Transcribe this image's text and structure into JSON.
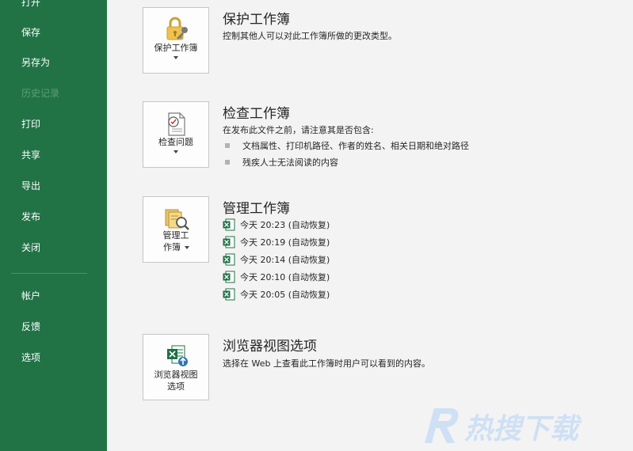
{
  "sidebar": {
    "items": [
      {
        "label": "打开",
        "disabled": false
      },
      {
        "label": "保存",
        "disabled": false
      },
      {
        "label": "另存为",
        "disabled": false
      },
      {
        "label": "历史记录",
        "disabled": true
      },
      {
        "label": "打印",
        "disabled": false
      },
      {
        "label": "共享",
        "disabled": false
      },
      {
        "label": "导出",
        "disabled": false
      },
      {
        "label": "发布",
        "disabled": false
      },
      {
        "label": "关闭",
        "disabled": false
      },
      {
        "label": "帐户",
        "disabled": false
      },
      {
        "label": "反馈",
        "disabled": false
      },
      {
        "label": "选项",
        "disabled": false
      }
    ]
  },
  "protect": {
    "tile_label": "保护工作簿",
    "title": "保护工作簿",
    "description": "控制其他人可以对此工作簿所做的更改类型。"
  },
  "inspect": {
    "tile_label": "检查问题",
    "title": "检查工作簿",
    "description": "在发布此文件之前，请注意其是否包含:",
    "bullets": [
      "文档属性、打印机路径、作者的姓名、相关日期和绝对路径",
      "残疾人士无法阅读的内容"
    ]
  },
  "manage": {
    "tile_label_line1": "管理工",
    "tile_label_line2": "作簿",
    "title": "管理工作簿",
    "versions": [
      "今天 20:23 (自动恢复)",
      "今天 20:19 (自动恢复)",
      "今天 20:14 (自动恢复)",
      "今天 20:10 (自动恢复)",
      "今天 20:05 (自动恢复)"
    ]
  },
  "browser": {
    "tile_label_line1": "浏览器视图",
    "tile_label_line2": "选项",
    "title": "浏览器视图选项",
    "description": "选择在 Web 上查看此工作簿时用户可以看到的内容。"
  },
  "watermark": {
    "text": "热搜下载"
  },
  "colors": {
    "sidebar": "#217346",
    "excel_green": "#1e7145",
    "disabled_text": "#5f9d7a"
  }
}
